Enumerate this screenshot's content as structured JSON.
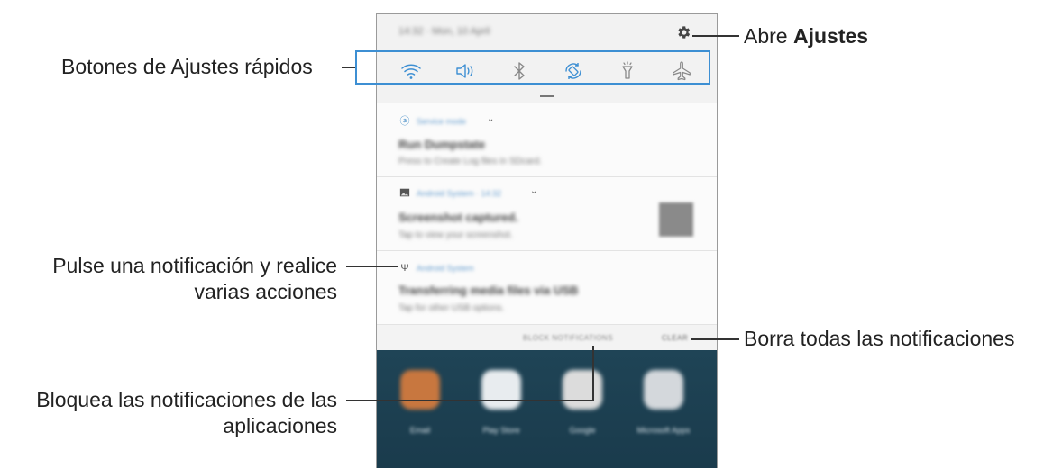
{
  "panel": {
    "status_text": "14:32 · Mon, 10 April",
    "quick_settings": [
      {
        "name": "wifi-icon",
        "active": true
      },
      {
        "name": "sound-icon",
        "active": true
      },
      {
        "name": "bluetooth-icon",
        "active": false
      },
      {
        "name": "auto-rotate-icon",
        "active": true
      },
      {
        "name": "flashlight-icon",
        "active": false
      },
      {
        "name": "airplane-mode-icon",
        "active": false
      }
    ],
    "notifications": [
      {
        "app": "Service mode",
        "title": "Run Dumpstate",
        "body": "Press to Create Log files in SDcard."
      },
      {
        "app": "Android System · 14:32",
        "title": "Screenshot captured.",
        "body": "Tap to view your screenshot."
      },
      {
        "app": "Android System",
        "title": "Transferring media files via USB",
        "body": "Tap for other USB options."
      }
    ],
    "block_label": "BLOCK NOTIFICATIONS",
    "clear_label": "CLEAR",
    "home_apps": [
      "Email",
      "Play Store",
      "Google",
      "Microsoft Apps"
    ]
  },
  "callouts": {
    "quick_settings": "Botones de Ajustes rápidos",
    "settings_prefix": "Abre ",
    "settings_bold": "Ajustes",
    "notification_line1": "Pulse una notificación y realice",
    "notification_line2": "varias acciones",
    "clear": "Borra todas las notificaciones",
    "block_line1": "Bloquea las notificaciones de las",
    "block_line2": "aplicaciones"
  },
  "colors": {
    "accent": "#3d8fd3",
    "home_background": "#1f4456"
  }
}
